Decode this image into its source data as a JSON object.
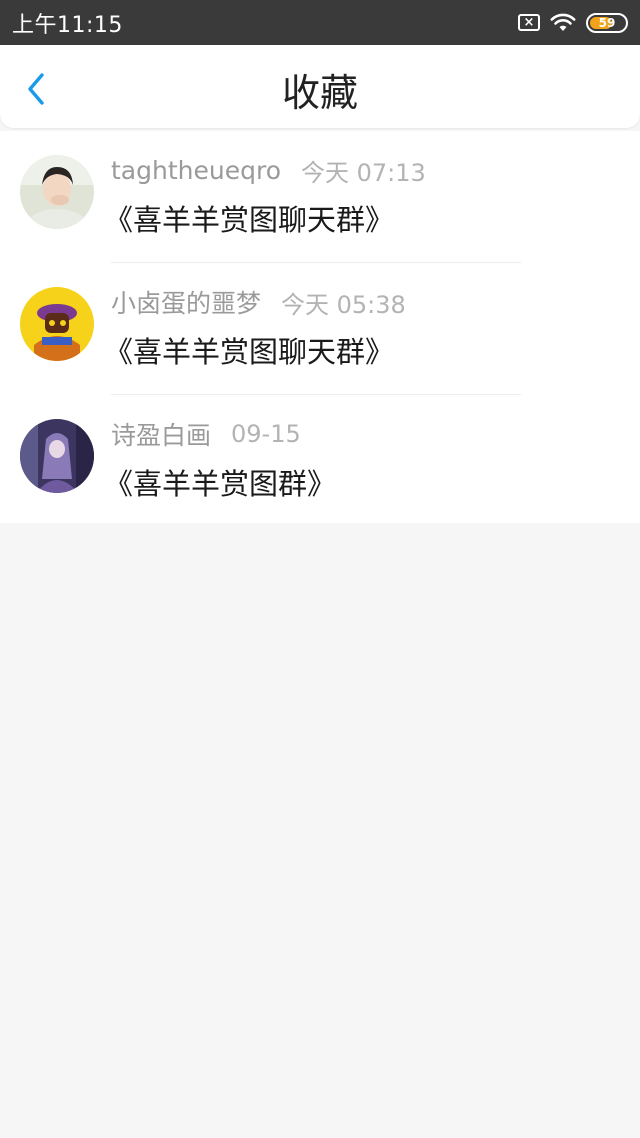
{
  "status_bar": {
    "time": "上午11:15",
    "sim_icon": "sim-error-icon",
    "wifi_icon": "wifi-icon",
    "battery_level": "59",
    "battery_color": "#f3a21c"
  },
  "header": {
    "back_icon": "chevron-left-icon",
    "title": "收藏",
    "accent_color": "#1a9be8"
  },
  "favorites": [
    {
      "sender": "taghtheueqro",
      "time": "今天 07:13",
      "message": "《喜羊羊赏图聊天群》",
      "avatar": "avatar-photo-person"
    },
    {
      "sender": "小卤蛋的噩梦",
      "time": "今天 05:38",
      "message": "《喜羊羊赏图聊天群》",
      "avatar": "avatar-cartoon-yellow"
    },
    {
      "sender": "诗盈白画",
      "time": "09-15",
      "message": "《喜羊羊赏图群》",
      "avatar": "avatar-anime-purple"
    }
  ]
}
